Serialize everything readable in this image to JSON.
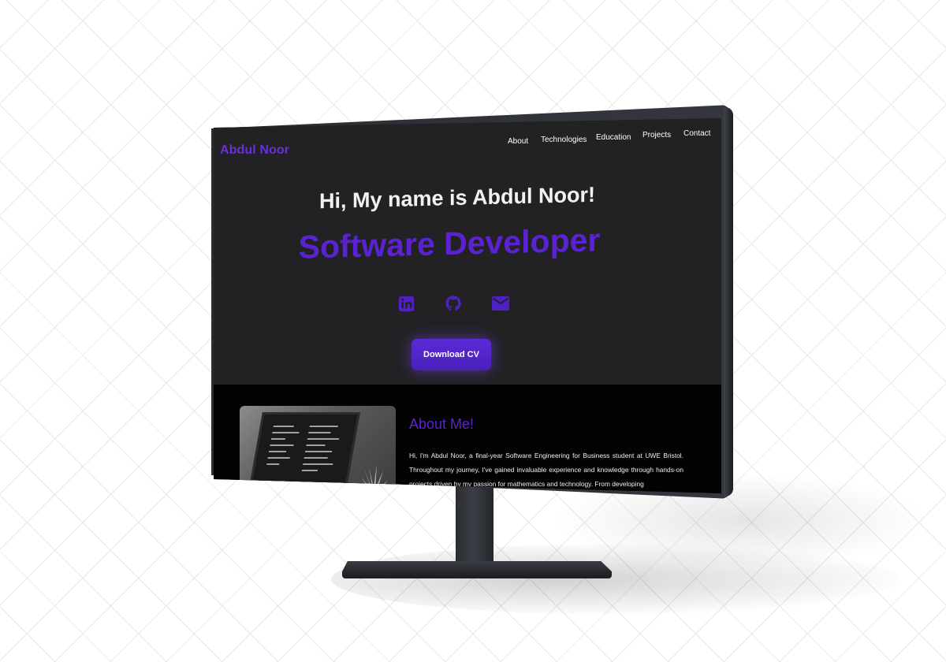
{
  "site": {
    "brand": "Abdul Noor",
    "nav": [
      {
        "label": "About"
      },
      {
        "label": "Technologies"
      },
      {
        "label": "Education"
      },
      {
        "label": "Projects"
      },
      {
        "label": "Contact"
      }
    ]
  },
  "hero": {
    "greeting": "Hi, My name is Abdul Noor!",
    "role": "Software Developer",
    "social_icons": [
      "linkedin-icon",
      "github-icon",
      "mail-icon"
    ],
    "cta_label": "Download CV"
  },
  "about": {
    "title": "About Me!",
    "text": "Hi, I'm Abdul Noor, a final-year Software Engineering for Business student at UWE Bristol. Throughout my journey, I've gained invaluable experience and knowledge through hands-on projects driven by my passion for mathematics and technology. From developing"
  },
  "colors": {
    "accent": "#5b22d3",
    "hero_bg": "#222224",
    "about_bg": "#030303",
    "bezel": "#2b2d33"
  }
}
